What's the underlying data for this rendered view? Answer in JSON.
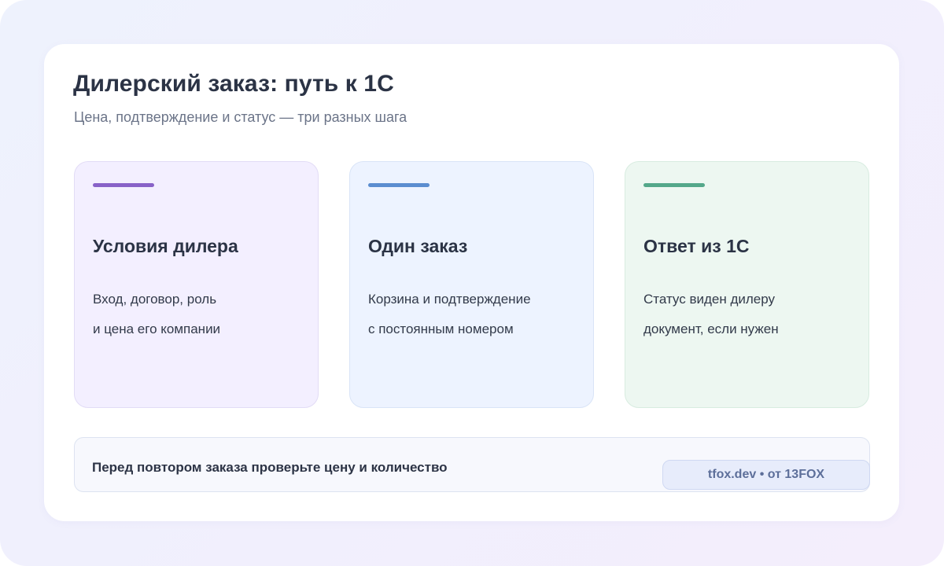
{
  "header": {
    "title": "Дилерский заказ: путь к 1С",
    "subtitle": "Цена, подтверждение и статус — три разных шага"
  },
  "steps": [
    {
      "title": "Условия дилера",
      "lines": [
        "Вход, договор, роль",
        "и цена его компании"
      ],
      "accent": "#8862c8"
    },
    {
      "title": "Один заказ",
      "lines": [
        "Корзина и подтверждение",
        "с постоянным номером"
      ],
      "accent": "#5b8dd0"
    },
    {
      "title": "Ответ из 1С",
      "lines": [
        "Статус виден дилеру",
        "документ, если нужен"
      ],
      "accent": "#54a88a"
    }
  ],
  "note": {
    "text": "Перед повтором заказа проверьте цену и количество"
  },
  "badge": {
    "text": "tfox.dev • от 13FOX"
  }
}
